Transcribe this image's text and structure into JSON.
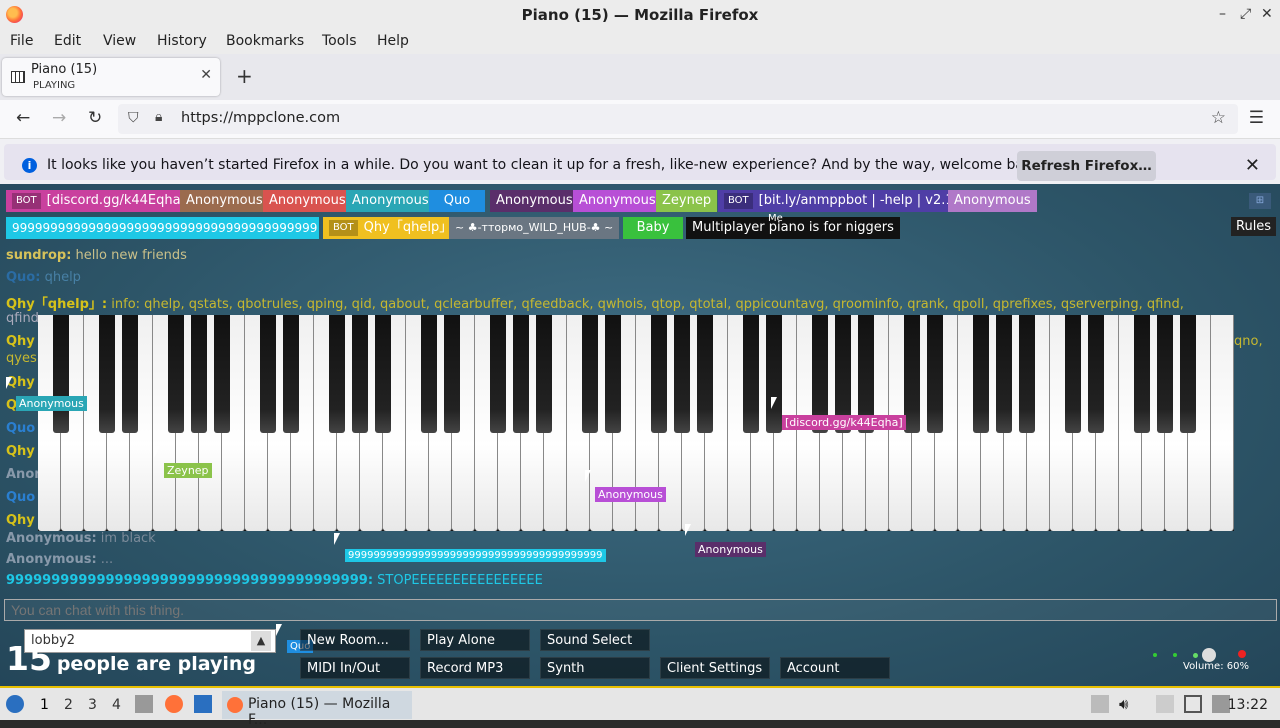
{
  "window": {
    "title": "Piano (15) — Mozilla Firefox"
  },
  "menu": [
    "File",
    "Edit",
    "View",
    "History",
    "Bookmarks",
    "Tools",
    "Help"
  ],
  "tab": {
    "title": "Piano (15)",
    "status": "PLAYING"
  },
  "nav": {
    "url": "https://mppclone.com"
  },
  "notification": {
    "message": "It looks like you haven’t started Firefox in a while. Do you want to clean it up for a fresh, like-new experience? And by the way, welcome back!",
    "button": "Refresh Firefox…"
  },
  "users_row1": [
    {
      "bot": "BOT",
      "name": "[discord.gg/k44Eqha]",
      "color": "#c9409e"
    },
    {
      "name": "Anonymous",
      "color": "#9b6b4e"
    },
    {
      "name": "Anonymous",
      "color": "#d9534f"
    },
    {
      "name": "Anonymous",
      "color": "#2aa6b5"
    },
    {
      "name": "Quo",
      "color": "#1f8ee0"
    },
    {
      "name": "Anonymous",
      "color": "#5a2e6a"
    },
    {
      "name": "Anonymous",
      "color": "#b84fd6"
    },
    {
      "name": "Zeynep",
      "color": "#8bc34a"
    },
    {
      "bot": "BOT",
      "name": "[bit.ly/anmppbot | -help | v2.1]",
      "color": "#4f3ea6"
    },
    {
      "name": "Anonymous",
      "color": "#b078c8"
    }
  ],
  "users_row2": [
    {
      "name": "9999999999999999999999999999999999999999",
      "color": "#1ec8e6"
    },
    {
      "bot": "BOT",
      "name": "Qhy「qhelp」",
      "color": "#f0c020"
    },
    {
      "name": "~ ♣-ттормо_WILD_HUB-♣ ~",
      "color": "#6a7682"
    },
    {
      "name": "Baby",
      "color": "#39c13d"
    },
    {
      "name": "Multiplayer piano is for niggers",
      "color": "#111111"
    }
  ],
  "me_label": "Me",
  "rules": "Rules",
  "chat": [
    {
      "name": "sundrop:",
      "text": "hello new friends",
      "color": "#d6c25a"
    },
    {
      "name": "Quo:",
      "text": "qhelp",
      "color": "#2a7fd0"
    },
    {
      "name": "Qhy「qhelp」:",
      "text": "info: qhelp, qstats, qbotrules, qping, qid, qabout, qclearbuffer, qfeedback, qwhois, qtop, qtotal, qppicountavg, qroominfo, qrank, qpoll, qprefixes, qserverping, qfind,",
      "color": "#d6c21a"
    },
    {
      "name": "qfind",
      "text": "",
      "color": "#aab"
    },
    {
      "name": "Anonymous:",
      "text": "im black",
      "color": "#8899aa"
    },
    {
      "name": "Anonymous:",
      "text": "...",
      "color": "#8899aa"
    },
    {
      "name": "9999999999999999999999999999999999999999:",
      "text": "STOPEEEEEEEEEEEEEEEE",
      "color": "#1ec8e6"
    }
  ],
  "chat_side_tags": [
    "Qhy",
    "qyes",
    "Qhy",
    "Qu",
    "Quo",
    "Qhy",
    "Anon",
    "Quo",
    "Qhy"
  ],
  "chat_right_tag": "qno,",
  "cursors": [
    {
      "name": "Anonymous",
      "color": "#2aa6b5"
    },
    {
      "name": "Zeynep",
      "color": "#8bc34a"
    },
    {
      "name": "[discord.gg/k44Eqha]",
      "color": "#c9409e"
    },
    {
      "name": "Anonymous",
      "color": "#b84fd6"
    },
    {
      "name": "Anonymous",
      "color": "#5a2e6a"
    },
    {
      "name": "9999999999999999999999999999999999999999",
      "color": "#1ec8e6"
    },
    {
      "name": "Quo",
      "color": "#1f8ee0"
    }
  ],
  "chat_input": {
    "placeholder": "You can chat with this thing."
  },
  "room": {
    "value": "lobby2"
  },
  "people": {
    "count": "15",
    "text": "people are playing"
  },
  "buttons_row1": [
    "New Room...",
    "Play Alone",
    "Sound Select"
  ],
  "buttons_row2": [
    "MIDI In/Out",
    "Record MP3",
    "Synth",
    "Client Settings",
    "Account"
  ],
  "volume": "Volume: 60%",
  "taskbar": {
    "workspaces": [
      "1",
      "2",
      "3",
      "4"
    ],
    "task": "Piano (15) — Mozilla F...",
    "clock": "13:22"
  }
}
